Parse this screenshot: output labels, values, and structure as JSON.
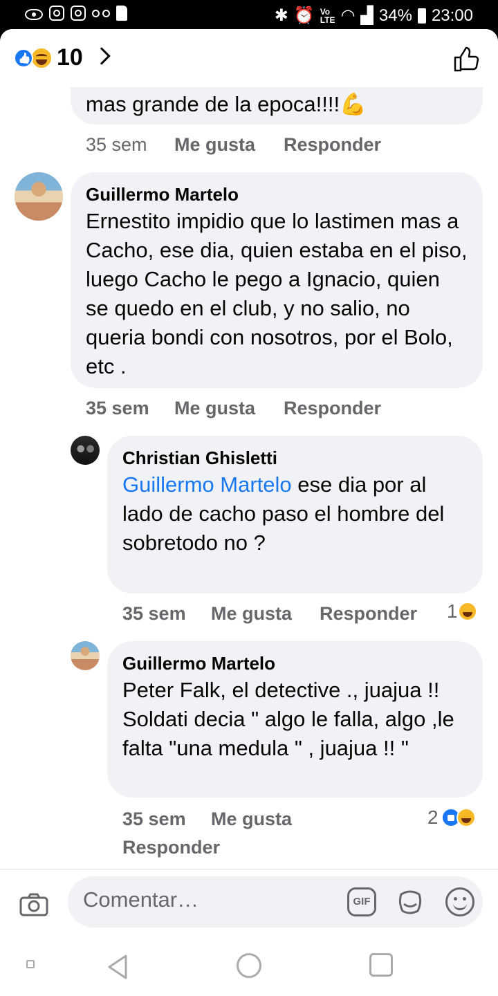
{
  "status_bar": {
    "volte": "Vo\nLTE",
    "battery": "34%",
    "time": "23:00"
  },
  "header": {
    "reaction_count": "10"
  },
  "comments": [
    {
      "text": "mas grande de la epoca!!!!💪",
      "time": "35 sem",
      "like": "Me gusta",
      "reply": "Responder"
    },
    {
      "author": "Guillermo Martelo",
      "text": "Ernestito impidio que lo lastimen mas a Cacho, ese dia, quien estaba en el piso, luego Cacho le pego a Ignacio, quien se quedo en el club, y no salio, no queria bondi con nosotros, por el Bolo, etc .",
      "time": "35 sem",
      "like": "Me gusta",
      "reply": "Responder"
    }
  ],
  "replies": [
    {
      "author": "Christian Ghisletti",
      "mention": "Guillermo Martelo",
      "text": " ese dia por al lado de cacho paso el hombre del sobretodo no ?",
      "time": "35 sem",
      "like": "Me gusta",
      "reply": "Responder",
      "reaction_count": "1"
    },
    {
      "author": "Guillermo Martelo",
      "text": "Peter Falk, el detective ., juajua !! Soldati decia \" algo le falla, algo ,le falta \"una medula \" , juajua !! \"",
      "time": "35 sem",
      "like": "Me gusta",
      "reply": "Responder",
      "reaction_count": "2"
    }
  ],
  "composer": {
    "placeholder": "Comentar…",
    "gif": "GIF"
  }
}
